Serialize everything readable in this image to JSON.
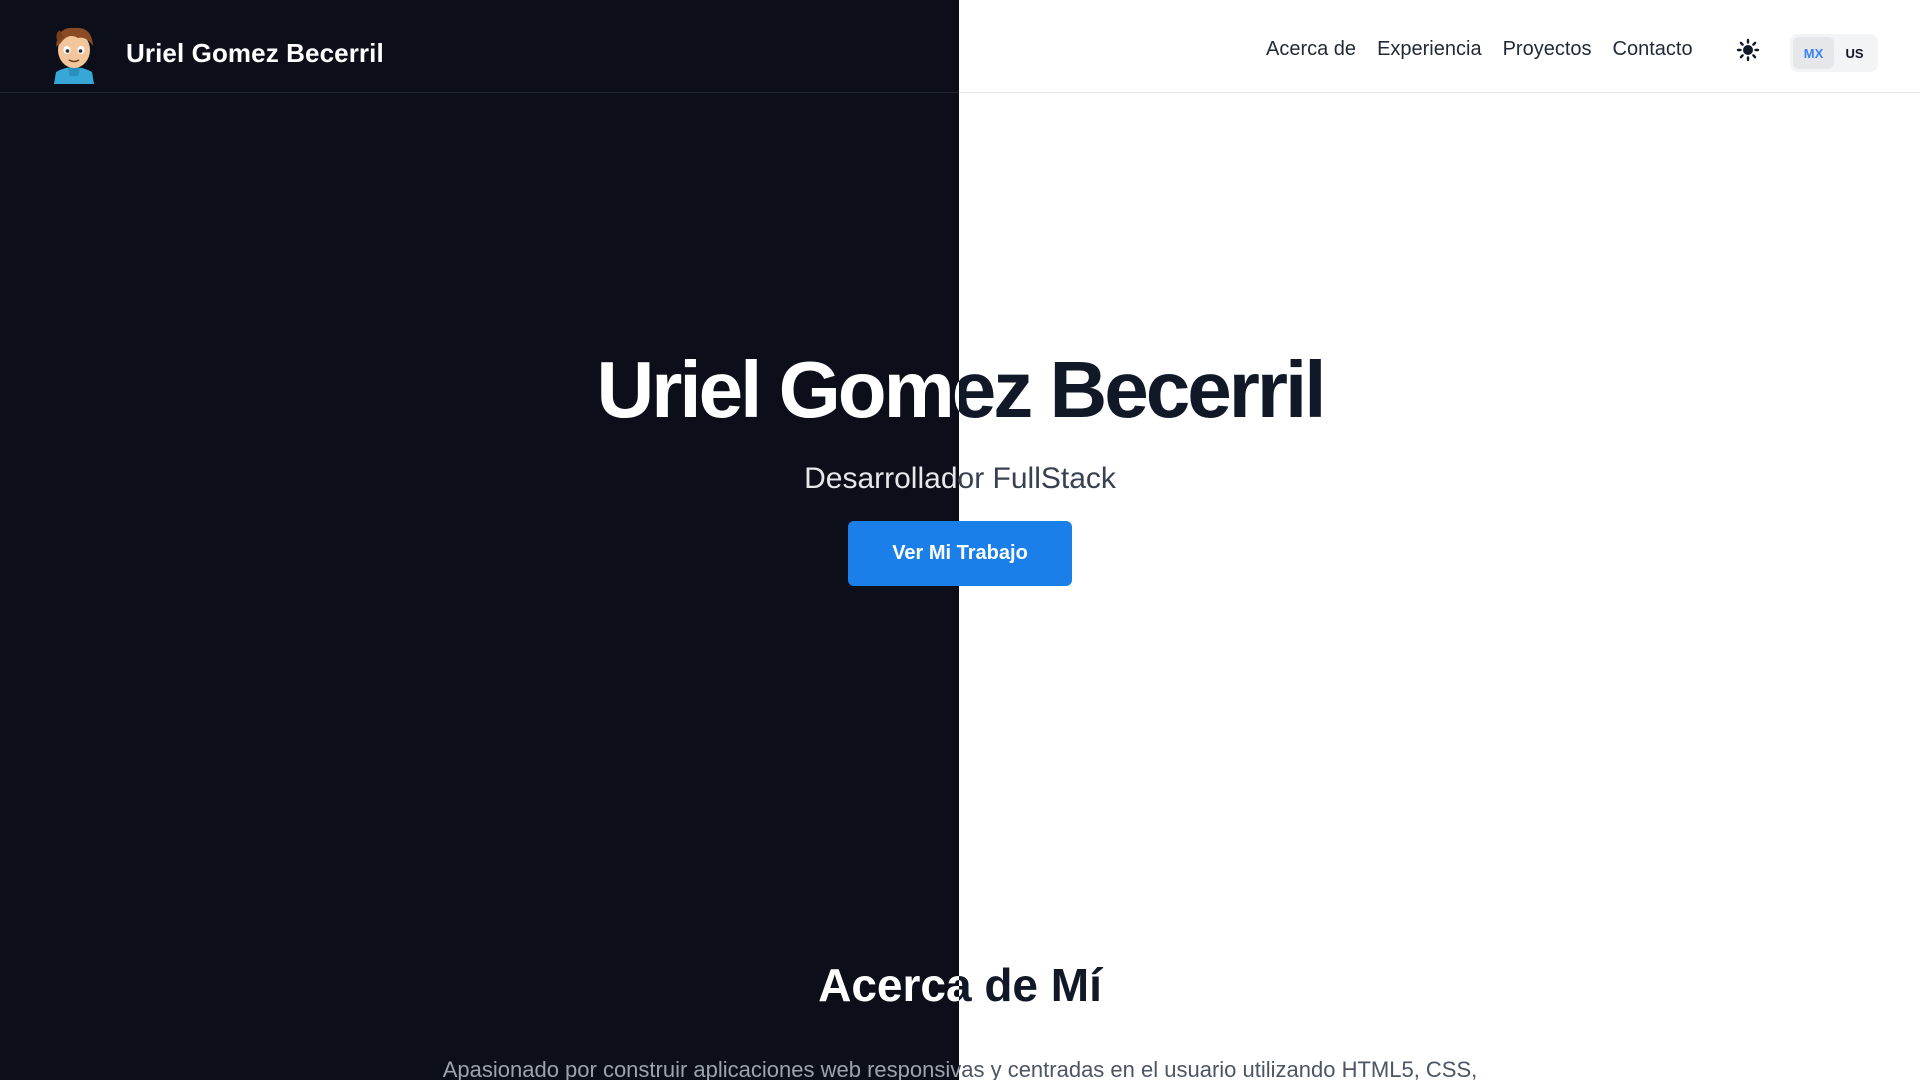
{
  "navbar": {
    "brand_name": "Uriel Gomez Becerril",
    "links": [
      "Acerca de",
      "Experiencia",
      "Proyectos",
      "Contacto"
    ],
    "theme_icon": "sun-icon",
    "languages": {
      "active": "MX",
      "inactive": "US"
    }
  },
  "hero": {
    "title": "Uriel Gomez Becerril",
    "subtitle": "Desarrollador FullStack",
    "cta_label": "Ver Mi Trabajo"
  },
  "about": {
    "title": "Acerca de Mí",
    "text": "Apasionado por construir aplicaciones web responsivas y centradas en el usuario utilizando HTML5, CSS,"
  },
  "colors": {
    "dark_bg": "#0c0f19",
    "light_bg": "#ffffff",
    "accent": "#1a7fe8"
  }
}
